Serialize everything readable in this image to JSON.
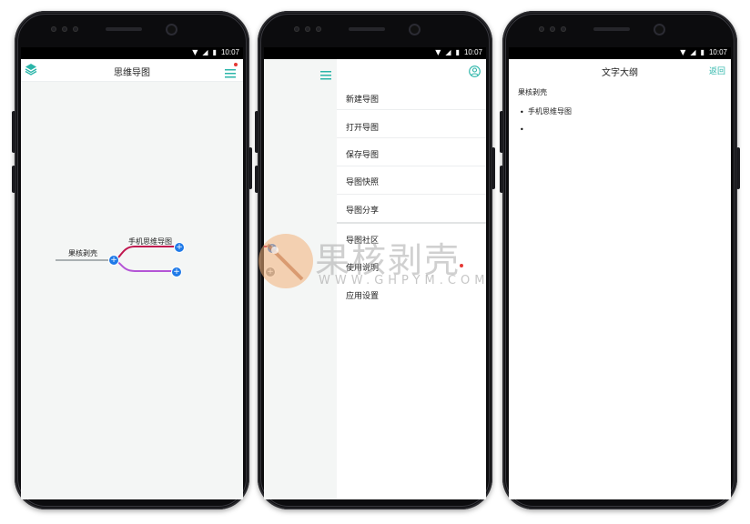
{
  "status": {
    "time": "10:07"
  },
  "screen1": {
    "title": "思维导图",
    "root_label": "果核剥壳",
    "child_label": "手机思维导图"
  },
  "screen2": {
    "menu_items": [
      {
        "label": "新建导图"
      },
      {
        "label": "打开导图"
      },
      {
        "label": "保存导图"
      },
      {
        "label": "导图快照"
      },
      {
        "label": "导图分享"
      },
      {
        "label": "导图社区"
      },
      {
        "label": "使用说明"
      },
      {
        "label": "应用设置"
      }
    ]
  },
  "screen3": {
    "title": "文字大纲",
    "back_label": "返回",
    "root": "果核剥壳",
    "bullets": [
      "手机思维导图",
      ""
    ]
  },
  "watermark": {
    "text": "果核剥壳",
    "url": "WWW.GHPYM.COM"
  },
  "colors": {
    "accent": "#2bb5a9",
    "node_blue": "#1f7ae8",
    "branch_red": "#c0174f",
    "branch_purple": "#b455d6",
    "badge_red": "#e53935"
  }
}
